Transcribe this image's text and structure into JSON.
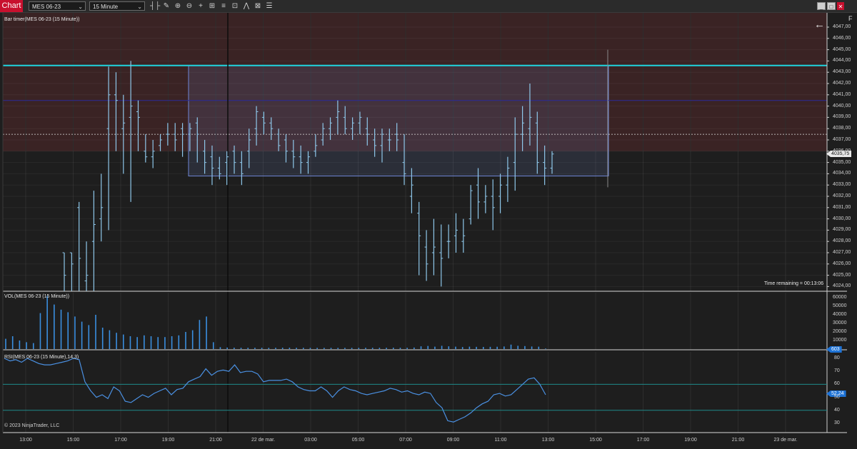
{
  "toolbar": {
    "tab_label": "Chart",
    "instrument": "MES 06-23",
    "interval": "15 Minute",
    "tools": [
      {
        "name": "bar-type-icon",
        "glyph": "┤├"
      },
      {
        "name": "drawing-tools-icon",
        "glyph": "✎"
      },
      {
        "name": "zoom-in-icon",
        "glyph": "⊕"
      },
      {
        "name": "zoom-out-icon",
        "glyph": "⊖"
      },
      {
        "name": "crosshair-icon",
        "glyph": "+"
      },
      {
        "name": "strategy-icon",
        "glyph": "⊞"
      },
      {
        "name": "properties-icon",
        "glyph": "≡"
      },
      {
        "name": "snapshot-icon",
        "glyph": "⊡"
      },
      {
        "name": "indicator-icon",
        "glyph": "⋀"
      },
      {
        "name": "data-box-icon",
        "glyph": "⊠"
      },
      {
        "name": "templates-icon",
        "glyph": "☰"
      }
    ],
    "window_buttons": {
      "minimize": "_",
      "restore": "□",
      "close": "✕"
    },
    "f_key": "F"
  },
  "panels": {
    "price": {
      "label": "Bar timer(MES 06-23 (15 Minute))",
      "time_remaining": "Time remaining = 00:13:06",
      "last_price": "4035,75"
    },
    "volume": {
      "label": "VOL(MES 06-23 (15 Minute))",
      "last_value": "603"
    },
    "rsi": {
      "label": "RSI(MES 06-23 (15 Minute),14,3)",
      "last_value": "52,24"
    }
  },
  "copyright": "© 2023 NinjaTrader, LLC",
  "colors": {
    "bar": "#8ec7ea",
    "vol": "#3a8fe0",
    "rsi": "#4a90e2",
    "cyan": "#1fd6e0",
    "blue_line": "#2a2a9a",
    "tag_blue": "#1e73d6"
  },
  "chart_data": [
    {
      "type": "ohlc",
      "name": "price",
      "y_ticks": [
        "4047,00",
        "4046,00",
        "4045,00",
        "4044,00",
        "4043,00",
        "4042,00",
        "4041,00",
        "4040,00",
        "4039,00",
        "4038,00",
        "4037,00",
        "4036,00",
        "4035,00",
        "4034,00",
        "4033,00",
        "4032,00",
        "4031,00",
        "4030,00",
        "4029,00",
        "4028,00",
        "4027,00",
        "4026,00",
        "4025,00",
        "4024,00"
      ],
      "ylim": [
        4023.5,
        4047.5
      ],
      "x_labels": [
        "13:00",
        "15:00",
        "17:00",
        "19:00",
        "21:00",
        "22 de mar.",
        "03:00",
        "05:00",
        "07:00",
        "09:00",
        "11:00",
        "13:00",
        "15:00",
        "17:00",
        "19:00",
        "21:00",
        "23 de mar."
      ],
      "levels": {
        "resistance_zone_low": 4036.0,
        "cyan_line": 4043.6,
        "dark_blue_line": 4040.5,
        "dashed_line": 4037.5,
        "rectangle_top": 4043.6,
        "rectangle_bottom": 4033.8
      },
      "bars": [
        [
          4027.0,
          4027.0,
          4023.5,
          4025.0
        ],
        [
          4027.0,
          4027.0,
          4023.5,
          4026.0
        ],
        [
          4031.0,
          4031.5,
          4023.5,
          4026.5
        ],
        [
          4024.5,
          4028.0,
          4023.5,
          4025.0
        ],
        [
          4028.0,
          4032.5,
          4023.5,
          4029.5
        ],
        [
          4030.0,
          4034.0,
          4028.0,
          4031.0
        ],
        [
          4038.0,
          4043.5,
          4029.0,
          4041.0
        ],
        [
          4041.0,
          4043.0,
          4036.0,
          4040.5
        ],
        [
          4038.0,
          4041.0,
          4034.0,
          4038.5
        ],
        [
          4039.0,
          4044.0,
          4031.5,
          4040.0
        ],
        [
          4039.5,
          4040.5,
          4036.0,
          4039.0
        ],
        [
          4036.0,
          4037.5,
          4035.0,
          4035.5
        ],
        [
          4035.5,
          4037.0,
          4034.5,
          4036.0
        ],
        [
          4036.5,
          4037.5,
          4036.0,
          4037.0
        ],
        [
          4037.5,
          4038.5,
          4036.5,
          4037.5
        ],
        [
          4037.5,
          4038.5,
          4036.0,
          4037.0
        ],
        [
          4038.0,
          4038.5,
          4035.5,
          4037.5
        ],
        [
          4037.5,
          4038.5,
          4036.0,
          4038.0
        ],
        [
          4038.5,
          4039.0,
          4035.0,
          4037.5
        ],
        [
          4036.0,
          4037.0,
          4034.0,
          4035.0
        ],
        [
          4035.5,
          4036.5,
          4033.0,
          4034.5
        ],
        [
          4034.5,
          4035.5,
          4033.5,
          4034.0
        ],
        [
          4035.0,
          4036.0,
          4033.0,
          4035.5
        ],
        [
          4036.0,
          4036.5,
          4034.0,
          4035.0
        ],
        [
          4035.0,
          4036.0,
          4033.0,
          4034.0
        ],
        [
          4036.0,
          4038.0,
          4034.5,
          4037.0
        ],
        [
          4038.0,
          4040.0,
          4036.5,
          4039.5
        ],
        [
          4039.0,
          4039.5,
          4037.5,
          4038.5
        ],
        [
          4038.5,
          4039.0,
          4037.0,
          4038.0
        ],
        [
          4037.5,
          4038.0,
          4036.0,
          4036.5
        ],
        [
          4037.0,
          4037.5,
          4035.0,
          4036.0
        ],
        [
          4036.0,
          4037.0,
          4034.5,
          4035.5
        ],
        [
          4035.5,
          4036.5,
          4034.0,
          4035.0
        ],
        [
          4035.0,
          4036.0,
          4034.0,
          4035.5
        ],
        [
          4036.0,
          4037.5,
          4035.5,
          4036.5
        ],
        [
          4037.0,
          4038.5,
          4036.5,
          4038.0
        ],
        [
          4038.0,
          4039.0,
          4037.0,
          4038.5
        ],
        [
          4039.0,
          4040.5,
          4037.5,
          4039.5
        ],
        [
          4039.0,
          4040.0,
          4037.5,
          4038.0
        ],
        [
          4038.0,
          4039.0,
          4037.0,
          4038.5
        ],
        [
          4038.5,
          4039.5,
          4037.5,
          4039.0
        ],
        [
          4038.0,
          4039.0,
          4036.5,
          4037.5
        ],
        [
          4037.0,
          4038.0,
          4035.5,
          4036.5
        ],
        [
          4036.5,
          4038.0,
          4035.0,
          4037.5
        ],
        [
          4037.0,
          4038.0,
          4036.0,
          4037.0
        ],
        [
          4037.5,
          4038.5,
          4036.0,
          4037.0
        ],
        [
          4035.0,
          4037.5,
          4033.0,
          4034.0
        ],
        [
          4032.0,
          4034.5,
          4030.5,
          4033.0
        ],
        [
          4030.5,
          4031.5,
          4025.0,
          4028.5
        ],
        [
          4027.5,
          4029.0,
          4024.5,
          4026.0
        ],
        [
          4027.0,
          4030.0,
          4025.0,
          4027.5
        ],
        [
          4027.0,
          4029.5,
          4024.0,
          4026.5
        ],
        [
          4028.0,
          4029.5,
          4026.5,
          4028.0
        ],
        [
          4028.5,
          4030.5,
          4027.0,
          4029.0
        ],
        [
          4028.0,
          4030.0,
          4027.0,
          4028.5
        ],
        [
          4030.0,
          4033.0,
          4029.5,
          4032.5
        ],
        [
          4033.0,
          4034.5,
          4030.0,
          4031.5
        ],
        [
          4031.5,
          4033.0,
          4030.5,
          4032.0
        ],
        [
          4032.0,
          4033.5,
          4029.0,
          4031.0
        ],
        [
          4032.0,
          4034.0,
          4030.5,
          4033.0
        ],
        [
          4033.0,
          4035.5,
          4031.5,
          4034.5
        ],
        [
          4035.0,
          4039.0,
          4032.5,
          4037.5
        ],
        [
          4037.5,
          4040.0,
          4036.0,
          4038.5
        ],
        [
          4038.0,
          4042.0,
          4036.5,
          4039.0
        ],
        [
          4038.5,
          4039.5,
          4034.0,
          4035.0
        ],
        [
          4035.0,
          4036.5,
          4033.0,
          4034.5
        ],
        [
          4034.5,
          4036.0,
          4034.0,
          4035.75
        ]
      ]
    },
    {
      "type": "bar",
      "name": "volume",
      "y_ticks": [
        "60000",
        "50000",
        "40000",
        "30000",
        "20000",
        "10000"
      ],
      "ylim": [
        0,
        62000
      ],
      "values": [
        12000,
        15000,
        10000,
        8000,
        7000,
        42000,
        62000,
        52000,
        46000,
        43000,
        38000,
        32000,
        28000,
        40000,
        25000,
        22000,
        19000,
        17000,
        15000,
        14000,
        16000,
        15000,
        14000,
        14000,
        15000,
        16000,
        20000,
        22000,
        34000,
        38000,
        8000,
        2200,
        1800,
        1600,
        1500,
        1500,
        1500,
        1500,
        1400,
        1500,
        1600,
        1600,
        1500,
        1500,
        1400,
        1400,
        1400,
        1400,
        1400,
        1400,
        1400,
        1400,
        1500,
        1500,
        1500,
        1500,
        1600,
        1500,
        1500,
        1800,
        3200,
        3600,
        2800,
        3800,
        3200,
        2800,
        2400,
        2800,
        2600,
        2500,
        2600,
        2700,
        3000,
        5200,
        3800,
        3500,
        3000,
        2800,
        603
      ]
    },
    {
      "type": "line",
      "name": "rsi",
      "y_ticks": [
        "80",
        "70",
        "60",
        "50",
        "40",
        "30"
      ],
      "ylim": [
        26,
        84
      ],
      "levels": [
        60,
        40
      ],
      "values": [
        80,
        78,
        79,
        77,
        80,
        78,
        76,
        75,
        75,
        76,
        77,
        78,
        80,
        79,
        62,
        55,
        50,
        52,
        49,
        58,
        55,
        47,
        46,
        49,
        52,
        50,
        53,
        55,
        57,
        52,
        56,
        57,
        62,
        64,
        66,
        72,
        67,
        70,
        71,
        70,
        75,
        69,
        70,
        70,
        68,
        62,
        63,
        63,
        63,
        64,
        62,
        58,
        56,
        55,
        55,
        58,
        55,
        50,
        55,
        58,
        56,
        55,
        53,
        52,
        53,
        54,
        55,
        57,
        56,
        54,
        55,
        53,
        52,
        54,
        53,
        46,
        42,
        32,
        31,
        33,
        35,
        38,
        42,
        45,
        47,
        52,
        53,
        51,
        52,
        56,
        60,
        64,
        65,
        60,
        52
      ]
    }
  ]
}
